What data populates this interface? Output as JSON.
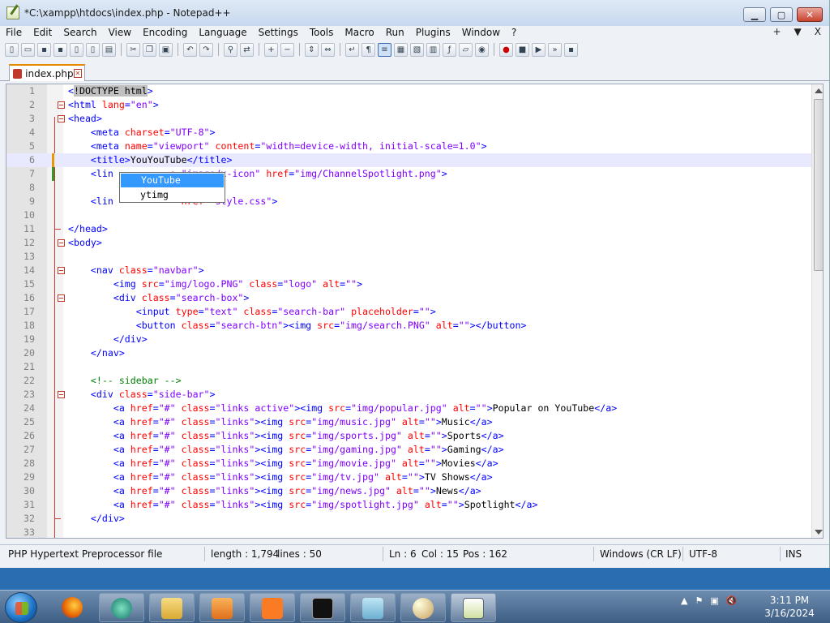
{
  "window": {
    "title": "*C:\\xampp\\htdocs\\index.php - Notepad++"
  },
  "menu": [
    "File",
    "Edit",
    "Search",
    "View",
    "Encoding",
    "Language",
    "Settings",
    "Tools",
    "Macro",
    "Run",
    "Plugins",
    "Window",
    "?"
  ],
  "menu_right": [
    "+",
    "▼",
    "X"
  ],
  "tab": {
    "label": "index.php"
  },
  "autocomplete": {
    "items": [
      "YouTube",
      "ytimg"
    ],
    "selected": 0
  },
  "status": {
    "file_type": "PHP Hypertext Preprocessor file",
    "length": "length : 1,794",
    "lines": "lines : 50",
    "ln": "Ln : 6",
    "col": "Col : 15",
    "pos": "Pos : 162",
    "eol": "Windows (CR LF)",
    "encoding": "UTF-8",
    "mode": "INS"
  },
  "clock": {
    "time": "3:11 PM",
    "date": "3/16/2024"
  },
  "code": [
    {
      "n": "1",
      "t": [
        [
          "tag",
          "<"
        ],
        [
          "sel",
          "!DOCTYPE html"
        ],
        [
          "tag",
          ">"
        ]
      ]
    },
    {
      "n": "2",
      "t": [
        [
          "tag",
          "<html "
        ],
        [
          "attr",
          "lang"
        ],
        [
          "tag",
          "="
        ],
        [
          "val",
          "\"en\""
        ],
        [
          "tag",
          ">"
        ]
      ]
    },
    {
      "n": "3",
      "t": [
        [
          "tag",
          "<head>"
        ]
      ]
    },
    {
      "n": "4",
      "t": [
        [
          "txt",
          "    "
        ],
        [
          "tag",
          "<meta "
        ],
        [
          "attr",
          "charset"
        ],
        [
          "tag",
          "="
        ],
        [
          "val",
          "\"UTF-8\""
        ],
        [
          "tag",
          ">"
        ]
      ]
    },
    {
      "n": "5",
      "t": [
        [
          "txt",
          "    "
        ],
        [
          "tag",
          "<meta "
        ],
        [
          "attr",
          "name"
        ],
        [
          "tag",
          "="
        ],
        [
          "val",
          "\"viewport\" "
        ],
        [
          "attr",
          "content"
        ],
        [
          "tag",
          "="
        ],
        [
          "val",
          "\"width=device-width, initial-scale=1.0\""
        ],
        [
          "tag",
          ">"
        ]
      ]
    },
    {
      "n": "6",
      "t": [
        [
          "txt",
          "    "
        ],
        [
          "tag",
          "<title>"
        ],
        [
          "txt",
          "YouYouTube"
        ],
        [
          "tag",
          "</title>"
        ]
      ]
    },
    {
      "n": "7",
      "t": [
        [
          "txt",
          "    "
        ],
        [
          "tag",
          "<lin"
        ],
        [
          "txt",
          "          "
        ],
        [
          "attr",
          "e"
        ],
        [
          "tag",
          "="
        ],
        [
          "val",
          "\"image/x-icon\" "
        ],
        [
          "attr",
          "href"
        ],
        [
          "tag",
          "="
        ],
        [
          "val",
          "\"img/ChannelSpotlight.png\""
        ],
        [
          "tag",
          ">"
        ]
      ]
    },
    {
      "n": "8",
      "t": []
    },
    {
      "n": "9",
      "t": [
        [
          "txt",
          "    "
        ],
        [
          "tag",
          "<lin"
        ],
        [
          "txt",
          "          "
        ],
        [
          "val",
          "\" "
        ],
        [
          "attr",
          "href"
        ],
        [
          "tag",
          "="
        ],
        [
          "val",
          "\"style.css\""
        ],
        [
          "tag",
          ">"
        ]
      ]
    },
    {
      "n": "10",
      "t": []
    },
    {
      "n": "11",
      "t": [
        [
          "tag",
          "</head>"
        ]
      ]
    },
    {
      "n": "12",
      "t": [
        [
          "tag",
          "<body>"
        ]
      ]
    },
    {
      "n": "13",
      "t": []
    },
    {
      "n": "14",
      "t": [
        [
          "txt",
          "    "
        ],
        [
          "tag",
          "<nav "
        ],
        [
          "attr",
          "class"
        ],
        [
          "tag",
          "="
        ],
        [
          "val",
          "\"navbar\""
        ],
        [
          "tag",
          ">"
        ]
      ]
    },
    {
      "n": "15",
      "t": [
        [
          "txt",
          "        "
        ],
        [
          "tag",
          "<img "
        ],
        [
          "attr",
          "src"
        ],
        [
          "tag",
          "="
        ],
        [
          "val",
          "\"img/logo.PNG\" "
        ],
        [
          "attr",
          "class"
        ],
        [
          "tag",
          "="
        ],
        [
          "val",
          "\"logo\" "
        ],
        [
          "attr",
          "alt"
        ],
        [
          "tag",
          "="
        ],
        [
          "val",
          "\"\""
        ],
        [
          "tag",
          ">"
        ]
      ]
    },
    {
      "n": "16",
      "t": [
        [
          "txt",
          "        "
        ],
        [
          "tag",
          "<div "
        ],
        [
          "attr",
          "class"
        ],
        [
          "tag",
          "="
        ],
        [
          "val",
          "\"search-box\""
        ],
        [
          "tag",
          ">"
        ]
      ]
    },
    {
      "n": "17",
      "t": [
        [
          "txt",
          "            "
        ],
        [
          "tag",
          "<input "
        ],
        [
          "attr",
          "type"
        ],
        [
          "tag",
          "="
        ],
        [
          "val",
          "\"text\" "
        ],
        [
          "attr",
          "class"
        ],
        [
          "tag",
          "="
        ],
        [
          "val",
          "\"search-bar\" "
        ],
        [
          "attr",
          "placeholder"
        ],
        [
          "tag",
          "="
        ],
        [
          "val",
          "\"\""
        ],
        [
          "tag",
          ">"
        ]
      ]
    },
    {
      "n": "18",
      "t": [
        [
          "txt",
          "            "
        ],
        [
          "tag",
          "<button "
        ],
        [
          "attr",
          "class"
        ],
        [
          "tag",
          "="
        ],
        [
          "val",
          "\"search-btn\""
        ],
        [
          "tag",
          "><img "
        ],
        [
          "attr",
          "src"
        ],
        [
          "tag",
          "="
        ],
        [
          "val",
          "\"img/search.PNG\" "
        ],
        [
          "attr",
          "alt"
        ],
        [
          "tag",
          "="
        ],
        [
          "val",
          "\"\""
        ],
        [
          "tag",
          "></button>"
        ]
      ]
    },
    {
      "n": "19",
      "t": [
        [
          "txt",
          "        "
        ],
        [
          "tag",
          "</div>"
        ]
      ]
    },
    {
      "n": "20",
      "t": [
        [
          "txt",
          "    "
        ],
        [
          "tag",
          "</nav>"
        ]
      ]
    },
    {
      "n": "21",
      "t": []
    },
    {
      "n": "22",
      "t": [
        [
          "txt",
          "    "
        ],
        [
          "cmt",
          "<!-- sidebar -->"
        ]
      ]
    },
    {
      "n": "23",
      "t": [
        [
          "txt",
          "    "
        ],
        [
          "tag",
          "<div "
        ],
        [
          "attr",
          "class"
        ],
        [
          "tag",
          "="
        ],
        [
          "val",
          "\"side-bar\""
        ],
        [
          "tag",
          ">"
        ]
      ]
    },
    {
      "n": "24",
      "t": [
        [
          "txt",
          "        "
        ],
        [
          "tag",
          "<a "
        ],
        [
          "attr",
          "href"
        ],
        [
          "tag",
          "="
        ],
        [
          "val",
          "\"#\" "
        ],
        [
          "attr",
          "class"
        ],
        [
          "tag",
          "="
        ],
        [
          "val",
          "\"links active\""
        ],
        [
          "tag",
          "><img "
        ],
        [
          "attr",
          "src"
        ],
        [
          "tag",
          "="
        ],
        [
          "val",
          "\"img/popular.jpg\" "
        ],
        [
          "attr",
          "alt"
        ],
        [
          "tag",
          "="
        ],
        [
          "val",
          "\"\""
        ],
        [
          "tag",
          ">"
        ],
        [
          "txt",
          "Popular on YouTube"
        ],
        [
          "tag",
          "</a>"
        ]
      ]
    },
    {
      "n": "25",
      "t": [
        [
          "txt",
          "        "
        ],
        [
          "tag",
          "<a "
        ],
        [
          "attr",
          "href"
        ],
        [
          "tag",
          "="
        ],
        [
          "val",
          "\"#\" "
        ],
        [
          "attr",
          "class"
        ],
        [
          "tag",
          "="
        ],
        [
          "val",
          "\"links\""
        ],
        [
          "tag",
          "><img "
        ],
        [
          "attr",
          "src"
        ],
        [
          "tag",
          "="
        ],
        [
          "val",
          "\"img/music.jpg\" "
        ],
        [
          "attr",
          "alt"
        ],
        [
          "tag",
          "="
        ],
        [
          "val",
          "\"\""
        ],
        [
          "tag",
          ">"
        ],
        [
          "txt",
          "Music"
        ],
        [
          "tag",
          "</a>"
        ]
      ]
    },
    {
      "n": "26",
      "t": [
        [
          "txt",
          "        "
        ],
        [
          "tag",
          "<a "
        ],
        [
          "attr",
          "href"
        ],
        [
          "tag",
          "="
        ],
        [
          "val",
          "\"#\" "
        ],
        [
          "attr",
          "class"
        ],
        [
          "tag",
          "="
        ],
        [
          "val",
          "\"links\""
        ],
        [
          "tag",
          "><img "
        ],
        [
          "attr",
          "src"
        ],
        [
          "tag",
          "="
        ],
        [
          "val",
          "\"img/sports.jpg\" "
        ],
        [
          "attr",
          "alt"
        ],
        [
          "tag",
          "="
        ],
        [
          "val",
          "\"\""
        ],
        [
          "tag",
          ">"
        ],
        [
          "txt",
          "Sports"
        ],
        [
          "tag",
          "</a>"
        ]
      ]
    },
    {
      "n": "27",
      "t": [
        [
          "txt",
          "        "
        ],
        [
          "tag",
          "<a "
        ],
        [
          "attr",
          "href"
        ],
        [
          "tag",
          "="
        ],
        [
          "val",
          "\"#\" "
        ],
        [
          "attr",
          "class"
        ],
        [
          "tag",
          "="
        ],
        [
          "val",
          "\"links\""
        ],
        [
          "tag",
          "><img "
        ],
        [
          "attr",
          "src"
        ],
        [
          "tag",
          "="
        ],
        [
          "val",
          "\"img/gaming.jpg\" "
        ],
        [
          "attr",
          "alt"
        ],
        [
          "tag",
          "="
        ],
        [
          "val",
          "\"\""
        ],
        [
          "tag",
          ">"
        ],
        [
          "txt",
          "Gaming"
        ],
        [
          "tag",
          "</a>"
        ]
      ]
    },
    {
      "n": "28",
      "t": [
        [
          "txt",
          "        "
        ],
        [
          "tag",
          "<a "
        ],
        [
          "attr",
          "href"
        ],
        [
          "tag",
          "="
        ],
        [
          "val",
          "\"#\" "
        ],
        [
          "attr",
          "class"
        ],
        [
          "tag",
          "="
        ],
        [
          "val",
          "\"links\""
        ],
        [
          "tag",
          "><img "
        ],
        [
          "attr",
          "src"
        ],
        [
          "tag",
          "="
        ],
        [
          "val",
          "\"img/movie.jpg\" "
        ],
        [
          "attr",
          "alt"
        ],
        [
          "tag",
          "="
        ],
        [
          "val",
          "\"\""
        ],
        [
          "tag",
          ">"
        ],
        [
          "txt",
          "Movies"
        ],
        [
          "tag",
          "</a>"
        ]
      ]
    },
    {
      "n": "29",
      "t": [
        [
          "txt",
          "        "
        ],
        [
          "tag",
          "<a "
        ],
        [
          "attr",
          "href"
        ],
        [
          "tag",
          "="
        ],
        [
          "val",
          "\"#\" "
        ],
        [
          "attr",
          "class"
        ],
        [
          "tag",
          "="
        ],
        [
          "val",
          "\"links\""
        ],
        [
          "tag",
          "><img "
        ],
        [
          "attr",
          "src"
        ],
        [
          "tag",
          "="
        ],
        [
          "val",
          "\"img/tv.jpg\" "
        ],
        [
          "attr",
          "alt"
        ],
        [
          "tag",
          "="
        ],
        [
          "val",
          "\"\""
        ],
        [
          "tag",
          ">"
        ],
        [
          "txt",
          "TV Shows"
        ],
        [
          "tag",
          "</a>"
        ]
      ]
    },
    {
      "n": "30",
      "t": [
        [
          "txt",
          "        "
        ],
        [
          "tag",
          "<a "
        ],
        [
          "attr",
          "href"
        ],
        [
          "tag",
          "="
        ],
        [
          "val",
          "\"#\" "
        ],
        [
          "attr",
          "class"
        ],
        [
          "tag",
          "="
        ],
        [
          "val",
          "\"links\""
        ],
        [
          "tag",
          "><img "
        ],
        [
          "attr",
          "src"
        ],
        [
          "tag",
          "="
        ],
        [
          "val",
          "\"img/news.jpg\" "
        ],
        [
          "attr",
          "alt"
        ],
        [
          "tag",
          "="
        ],
        [
          "val",
          "\"\""
        ],
        [
          "tag",
          ">"
        ],
        [
          "txt",
          "News"
        ],
        [
          "tag",
          "</a>"
        ]
      ]
    },
    {
      "n": "31",
      "t": [
        [
          "txt",
          "        "
        ],
        [
          "tag",
          "<a "
        ],
        [
          "attr",
          "href"
        ],
        [
          "tag",
          "="
        ],
        [
          "val",
          "\"#\" "
        ],
        [
          "attr",
          "class"
        ],
        [
          "tag",
          "="
        ],
        [
          "val",
          "\"links\""
        ],
        [
          "tag",
          "><img "
        ],
        [
          "attr",
          "src"
        ],
        [
          "tag",
          "="
        ],
        [
          "val",
          "\"img/spotlight.jpg\" "
        ],
        [
          "attr",
          "alt"
        ],
        [
          "tag",
          "="
        ],
        [
          "val",
          "\"\""
        ],
        [
          "tag",
          ">"
        ],
        [
          "txt",
          "Spotlight"
        ],
        [
          "tag",
          "</a>"
        ]
      ]
    },
    {
      "n": "32",
      "t": [
        [
          "txt",
          "    "
        ],
        [
          "tag",
          "</div>"
        ]
      ]
    },
    {
      "n": "33",
      "t": []
    }
  ],
  "fold_lines": [
    "2",
    "3",
    "12",
    "14",
    "16",
    "23"
  ],
  "foldend_lines": [
    "11",
    "32"
  ],
  "current_line": "6"
}
